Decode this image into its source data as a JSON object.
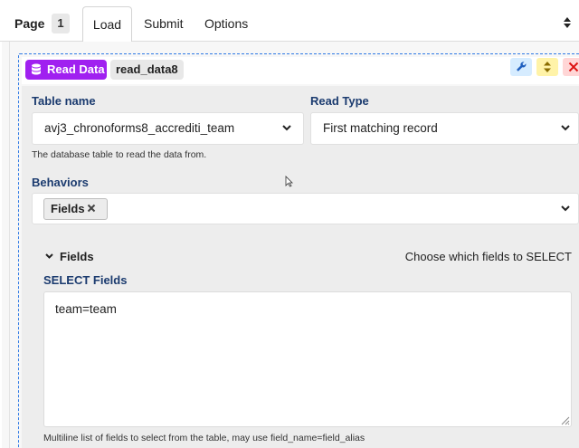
{
  "topbar": {
    "page_label": "Page",
    "page_number": "1",
    "tabs": [
      {
        "label": "Load",
        "active": true
      },
      {
        "label": "Submit",
        "active": false
      },
      {
        "label": "Options",
        "active": false
      }
    ]
  },
  "block": {
    "type_label": "Read Data",
    "name": "read_data8",
    "colors": {
      "badge": "#a020f0",
      "border": "#2f7ae5"
    }
  },
  "form": {
    "table_name_label": "Table name",
    "table_name_value": "avj3_chronoforms8_accrediti_team",
    "table_name_hint": "The database table to read the data from.",
    "read_type_label": "Read Type",
    "read_type_value": "First matching record",
    "behaviors_label": "Behaviors",
    "behavior_chip": "Fields",
    "fields_section_title": "Fields",
    "fields_section_note": "Choose which fields to SELECT",
    "select_fields_label": "SELECT Fields",
    "select_fields_value": "team=team",
    "select_fields_hint": "Multiline list of fields to select from the table, may use field_name=field_alias"
  },
  "icons": {
    "database": "database-icon",
    "wrench": "wrench-icon",
    "sort": "sort-icon",
    "close": "close-icon",
    "chevron": "chevron-down-icon",
    "chip_remove": "close-icon"
  }
}
